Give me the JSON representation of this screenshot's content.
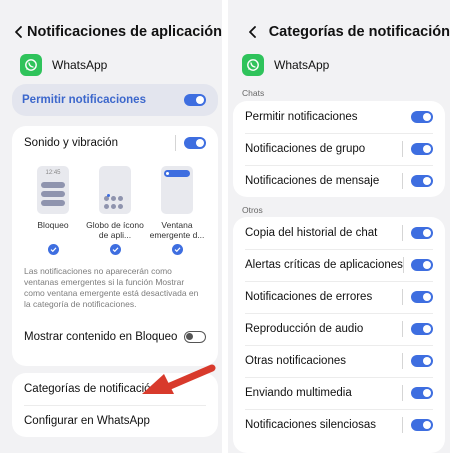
{
  "left": {
    "title": "Notificaciones de aplicación",
    "app_name": "WhatsApp",
    "allow_label": "Permitir notificaciones",
    "sound_label": "Sonido y vibración",
    "styles": [
      {
        "label": "Bloqueo",
        "clock": "12:45"
      },
      {
        "label": "Globo de ícono de apli..."
      },
      {
        "label": "Ventana emergente d..."
      }
    ],
    "note": "Las notificaciones no aparecerán como ventanas emergentes si la función Mostrar como ventana emergente está desactivada en la categoría de notificaciones.",
    "lock_label": "Mostrar contenido en Bloqueo",
    "categories_label": "Categorías de notificación",
    "configure_label": "Configurar en WhatsApp"
  },
  "right": {
    "title": "Categorías de notificación",
    "app_name": "WhatsApp",
    "section_chats": "Chats",
    "chats": [
      {
        "label": "Permitir notificaciones"
      },
      {
        "label": "Notificaciones de grupo"
      },
      {
        "label": "Notificaciones de mensaje"
      }
    ],
    "section_others": "Otros",
    "others": [
      {
        "label": "Copia del historial de chat"
      },
      {
        "label": "Alertas críticas de aplicaciones"
      },
      {
        "label": "Notificaciones de errores"
      },
      {
        "label": "Reproducción de audio"
      },
      {
        "label": "Otras notificaciones"
      },
      {
        "label": "Enviando multimedia"
      },
      {
        "label": "Notificaciones silenciosas"
      }
    ]
  },
  "colors": {
    "accent": "#3e6ee0",
    "whatsapp_green": "#2fc35b",
    "arrow_red": "#d83a2c"
  },
  "icons": [
    "back-arrow-icon",
    "whatsapp-icon",
    "check-icon",
    "red-arrow-annotation"
  ]
}
